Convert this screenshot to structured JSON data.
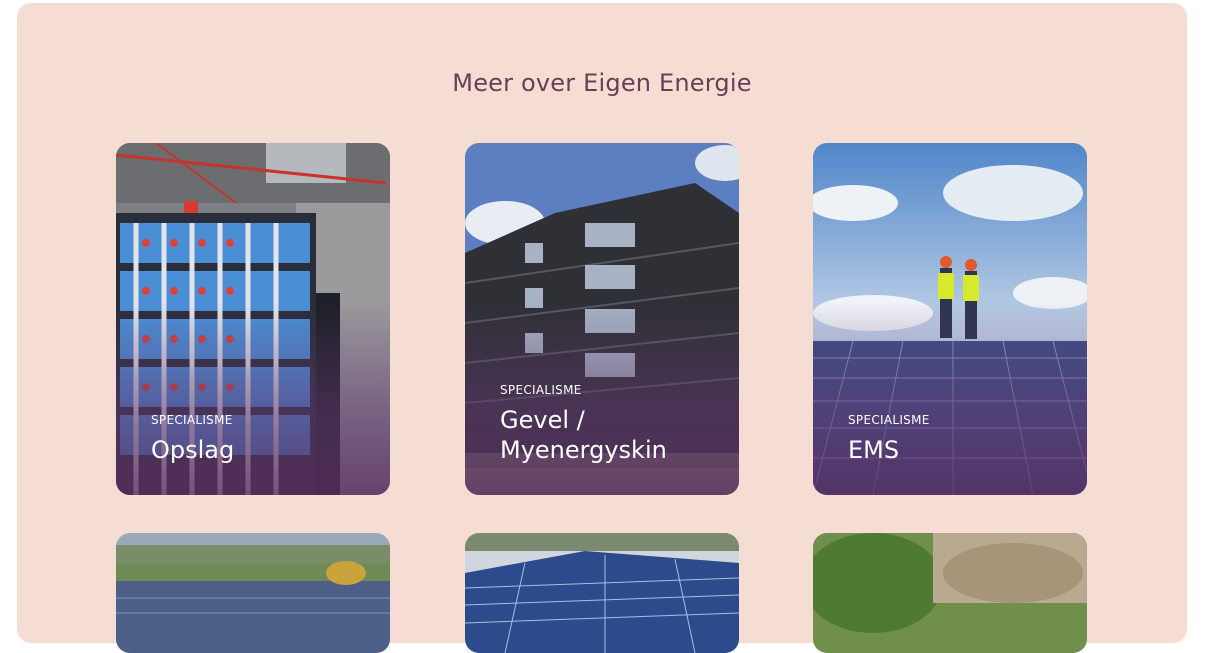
{
  "section": {
    "title": "Meer over Eigen Energie"
  },
  "cards": [
    {
      "eyebrow": "SPECIALISME",
      "name": "Opslag",
      "image_icon": "battery-storage-photo"
    },
    {
      "eyebrow": "SPECIALISME",
      "name": "Gevel / Myenergyskin",
      "image_icon": "building-facade-photo"
    },
    {
      "eyebrow": "SPECIALISME",
      "name": "EMS",
      "image_icon": "solar-roof-workers-photo"
    }
  ],
  "colors": {
    "panel_bg": "#f5ddd3",
    "title": "#6a3f55",
    "overlay": "#5f376e"
  }
}
